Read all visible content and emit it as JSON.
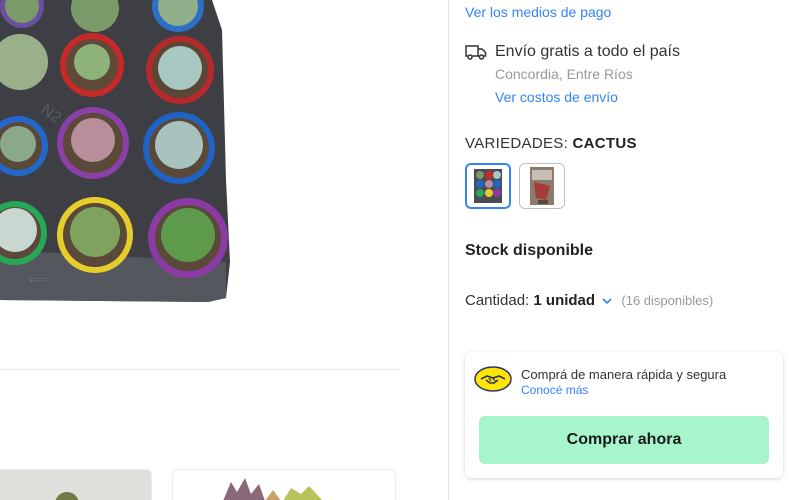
{
  "product": {
    "image_alt": "bandeja de suculentas en macetas de colores"
  },
  "payment": {
    "link": "Ver los medios de pago"
  },
  "shipping": {
    "title": "Envío gratis a todo el país",
    "location": "Concordia, Entre Ríos",
    "cost_link": "Ver costos de envío",
    "icon": "truck-icon"
  },
  "variants": {
    "label": "VARIEDADES:",
    "selected": "CACTUS",
    "options": [
      {
        "name": "variedad-1"
      },
      {
        "name": "variedad-2"
      }
    ]
  },
  "stock": {
    "label": "Stock disponible"
  },
  "quantity": {
    "label": "Cantidad:",
    "value": "1 unidad",
    "available": "(16 disponibles)"
  },
  "buy_box": {
    "secure_title": "Comprá de manera rápida y segura",
    "learn_more": "Conocé más",
    "button": "Comprar ahora",
    "icon": "handshake-icon"
  },
  "colors": {
    "link": "#3483fa",
    "buy_button": "#a6f5cb",
    "mp_yellow": "#ffe600"
  }
}
